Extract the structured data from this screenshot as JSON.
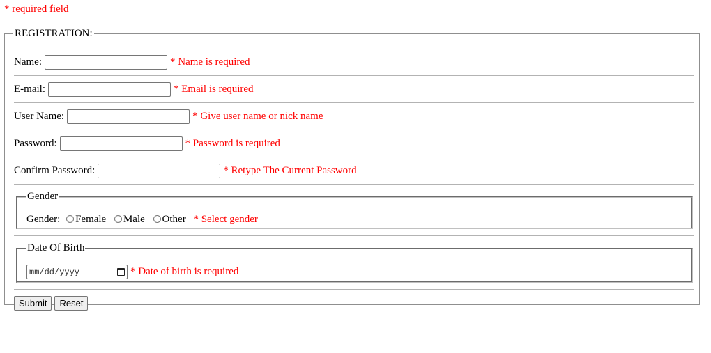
{
  "required_note": "* required field",
  "form": {
    "legend": "REGISTRATION:",
    "fields": [
      {
        "label": "Name:",
        "value": "",
        "error": "* Name is required"
      },
      {
        "label": "E-mail:",
        "value": "",
        "error": "* Email is required"
      },
      {
        "label": "User Name:",
        "value": "",
        "error": "* Give user name or nick name"
      },
      {
        "label": "Password:",
        "value": "",
        "error": "* Password is required"
      },
      {
        "label": "Confirm Password:",
        "value": "",
        "error": "* Retype The Current Password"
      }
    ],
    "gender": {
      "legend": "Gender",
      "label": "Gender:",
      "options": [
        "Female",
        "Male",
        "Other"
      ],
      "error": "* Select gender"
    },
    "dob": {
      "legend": "Date Of Birth",
      "placeholder": "mm/dd/yyyy",
      "error": "* Date of birth is required"
    },
    "buttons": {
      "submit": "Submit",
      "reset": "Reset"
    }
  },
  "colors": {
    "error": "#ff0000",
    "border": "#8f8f8f"
  },
  "icons": {
    "date_picker": "calendar-icon",
    "radio": "radio-circle"
  }
}
